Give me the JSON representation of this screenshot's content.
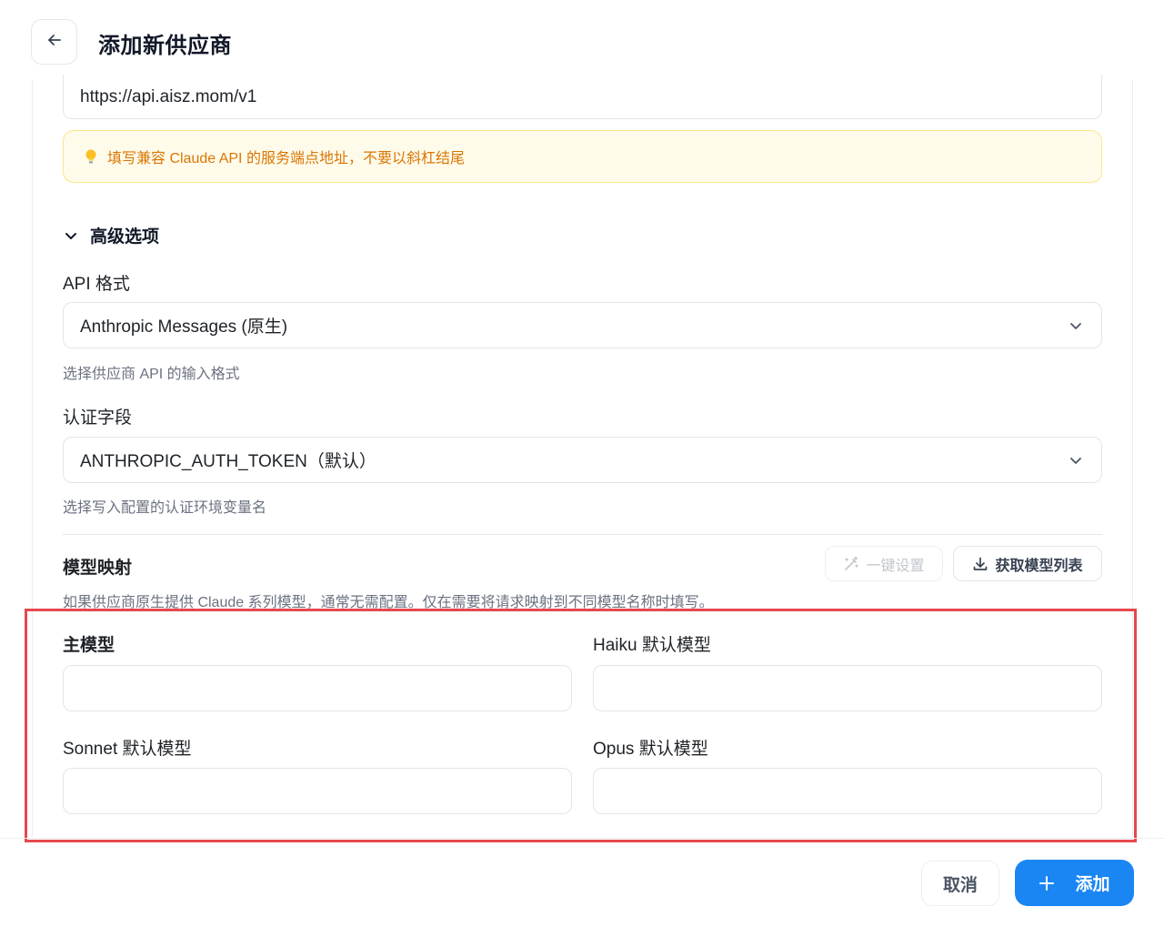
{
  "header": {
    "title": "添加新供应商"
  },
  "endpoint": {
    "value": "https://api.aisz.mom/v1",
    "hint": "填写兼容 Claude API 的服务端点地址，不要以斜杠结尾"
  },
  "advanced": {
    "toggle_label": "高级选项",
    "api_format": {
      "label": "API 格式",
      "selected": "Anthropic Messages (原生)",
      "help": "选择供应商 API 的输入格式"
    },
    "auth_field": {
      "label": "认证字段",
      "selected": "ANTHROPIC_AUTH_TOKEN（默认）",
      "help": "选择写入配置的认证环境变量名"
    }
  },
  "model_mapping": {
    "title": "模型映射",
    "quick_setup_label": "一键设置",
    "fetch_models_label": "获取模型列表",
    "help": "如果供应商原生提供 Claude 系列模型，通常无需配置。仅在需要将请求映射到不同模型名称时填写。",
    "fields": {
      "main_label": "主模型",
      "main_value": "",
      "haiku_label": "Haiku 默认模型",
      "haiku_value": "",
      "sonnet_label": "Sonnet 默认模型",
      "sonnet_value": "",
      "opus_label": "Opus 默认模型",
      "opus_value": ""
    }
  },
  "footer": {
    "cancel_label": "取消",
    "add_label": "添加"
  },
  "colors": {
    "accent": "#1a86f3",
    "hint_bg": "#fffbea",
    "hint_text": "#d97706",
    "highlight": "#e5484d"
  },
  "icons": [
    "arrow-left-icon",
    "lightbulb-icon",
    "chevron-down-icon",
    "magic-wand-icon",
    "download-icon",
    "plus-icon"
  ]
}
